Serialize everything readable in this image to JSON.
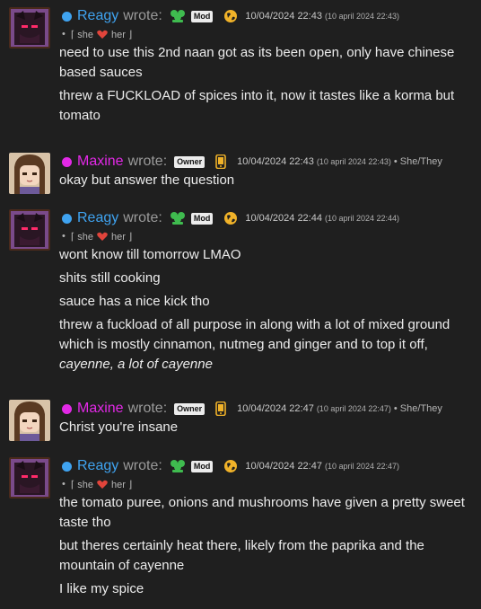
{
  "colors": {
    "background": "#1f1f1f",
    "reagy_name": "#3fa3f0",
    "maxine_name": "#e229e6",
    "mod_icon": "#3fbb4f",
    "globe_icon": "#f0b229",
    "phone_icon": "#f0b229",
    "heart": "#e0443b"
  },
  "posts": [
    {
      "author": "Reagy",
      "wrote": "wrote:",
      "role_icon": "mod-icon",
      "badge": "Mod",
      "device_icon": "globe-icon",
      "timestamp": "10/04/2024 22:43",
      "timestamp_full": "(10 april 2024 22:43)",
      "pronoun_parts": [
        "⌈ she",
        "her ⌋"
      ],
      "lines": [
        "need to use this 2nd naan got as its been open, only have chinese based sauces",
        "threw a FUCKLOAD of spices into it, now it tastes like a korma but tomato"
      ]
    },
    {
      "author": "Maxine",
      "wrote": "wrote:",
      "badge": "Owner",
      "device_icon": "phone-icon",
      "timestamp": "10/04/2024 22:43",
      "timestamp_full": "(10 april 2024 22:43)",
      "pronouns": "• She/They",
      "lines": [
        "okay but answer the question"
      ]
    },
    {
      "author": "Reagy",
      "wrote": "wrote:",
      "role_icon": "mod-icon",
      "badge": "Mod",
      "device_icon": "globe-icon",
      "timestamp": "10/04/2024 22:44",
      "timestamp_full": "(10 april 2024 22:44)",
      "pronoun_parts": [
        "⌈ she",
        "her ⌋"
      ],
      "lines": [
        "wont know till tomorrow LMAO",
        "shits still cooking",
        "sauce has a nice kick tho",
        "threw a fuckload of all purpose in along with a lot of mixed ground which is mostly cinnamon, nutmeg and ginger and to top it off,",
        "cayenne, a lot of cayenne"
      ]
    },
    {
      "author": "Maxine",
      "wrote": "wrote:",
      "badge": "Owner",
      "device_icon": "phone-icon",
      "timestamp": "10/04/2024 22:47",
      "timestamp_full": "(10 april 2024 22:47)",
      "pronouns": "• She/They",
      "lines": [
        "Christ you're insane"
      ]
    },
    {
      "author": "Reagy",
      "wrote": "wrote:",
      "role_icon": "mod-icon",
      "badge": "Mod",
      "device_icon": "globe-icon",
      "timestamp": "10/04/2024 22:47",
      "timestamp_full": "(10 april 2024 22:47)",
      "pronoun_parts": [
        "⌈ she",
        "her ⌋"
      ],
      "lines": [
        "the tomato puree, onions and mushrooms have given a pretty sweet taste tho",
        "but theres certainly heat there, likely from the paprika and the mountain of cayenne",
        "I like my spice"
      ]
    }
  ]
}
